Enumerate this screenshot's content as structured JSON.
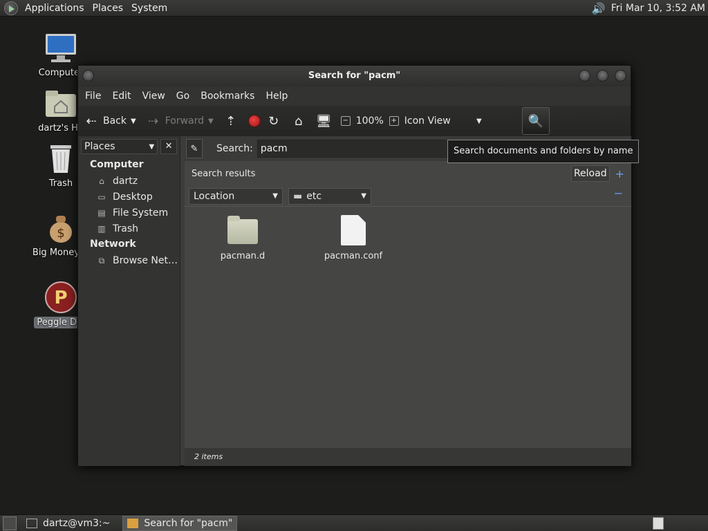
{
  "top_panel": {
    "menus": [
      "Applications",
      "Places",
      "System"
    ],
    "clock": "Fri Mar 10,  3:52 AM"
  },
  "desktop": {
    "icons": [
      {
        "label": "Computer"
      },
      {
        "label": "dartz's Ho"
      },
      {
        "label": "Trash"
      },
      {
        "label": "Big Money D"
      },
      {
        "label": "Peggle Del"
      }
    ]
  },
  "window": {
    "title": "Search for \"pacm\"",
    "menu": [
      "File",
      "Edit",
      "View",
      "Go",
      "Bookmarks",
      "Help"
    ],
    "toolbar": {
      "back": "Back",
      "forward": "Forward",
      "zoom": "100%",
      "view": "Icon View"
    },
    "sidebar": {
      "combo": "Places",
      "close": "✕",
      "computer_head": "Computer",
      "computer_items": [
        "dartz",
        "Desktop",
        "File System",
        "Trash"
      ],
      "network_head": "Network",
      "network_items": [
        "Browse Net…"
      ]
    },
    "search": {
      "label": "Search:",
      "value": "pacm",
      "tooltip": "Search documents and folders by name"
    },
    "results": {
      "title": "Search results",
      "reload": "Reload",
      "filter_type": "Location",
      "filter_value": "etc"
    },
    "files": [
      {
        "name": "pacman.d",
        "type": "folder"
      },
      {
        "name": "pacman.conf",
        "type": "file"
      }
    ],
    "status": "2 items"
  },
  "bottom_panel": {
    "tasks": [
      "dartz@vm3:~",
      "Search for \"pacm\""
    ]
  },
  "colors": {
    "desktop": "#1d1e1c",
    "panel": "#2c2d2b",
    "accent": "#6aa0e8"
  }
}
